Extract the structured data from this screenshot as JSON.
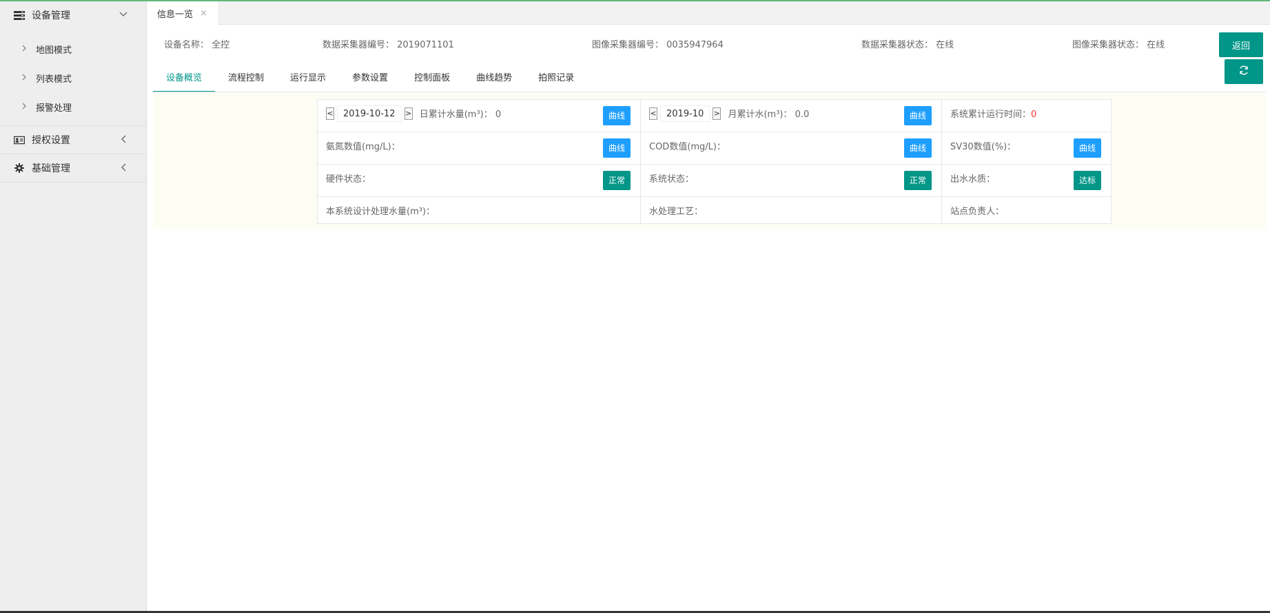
{
  "sidebar": {
    "groups": [
      {
        "label": "设备管理",
        "icon": "server-icon",
        "items": [
          "地图模式",
          "列表模式",
          "报警处理"
        ]
      },
      {
        "label": "授权设置",
        "icon": "id-card-icon"
      },
      {
        "label": "基础管理",
        "icon": "gear-icon"
      }
    ]
  },
  "tabbar": {
    "open_tab": "信息一览",
    "close": "×"
  },
  "info": {
    "device_name": "设备名称：  全控",
    "data_collector": "数据采集器编号：  2019071101",
    "image_collector": "图像采集器编号：  0035947964",
    "data_status": "数据采集器状态：  在线",
    "image_status": "图像采集器状态：  在线"
  },
  "buttons": {
    "back": "返回",
    "refresh_icon": "refresh-icon"
  },
  "subtabs": [
    "设备概览",
    "流程控制",
    "运行显示",
    "参数设置",
    "控制面板",
    "曲线趋势",
    "拍照记录"
  ],
  "grid": {
    "row1": {
      "date": "2019-10-12",
      "daily_label": "日累计水量(m³)：  0",
      "month": "2019-10",
      "monthly_label": "月累计水(m³)：  0.0",
      "runtime_label": "系统累计运行时间：",
      "runtime_value": "0"
    },
    "row2": {
      "nh": "氨氮数值(mg/L)：",
      "cod": "COD数值(mg/L)：",
      "sv30": "SV30数值(%)："
    },
    "row3": {
      "hardware": "硬件状态：",
      "hardware_btn": "正常",
      "system": "系统状态：",
      "system_btn": "正常",
      "water": "出水水质：",
      "water_btn": "达标"
    },
    "row4": {
      "capacity": "本系统设计处理水量(m³)：",
      "process": "水处理工艺：",
      "manager": "站点负责人："
    },
    "curve": "曲线",
    "prev": "<",
    "next": ">"
  },
  "colors": {
    "accent": "#009688",
    "blue": "#1E9FFF",
    "red": "#FF3333",
    "topline": "#5FB878"
  }
}
